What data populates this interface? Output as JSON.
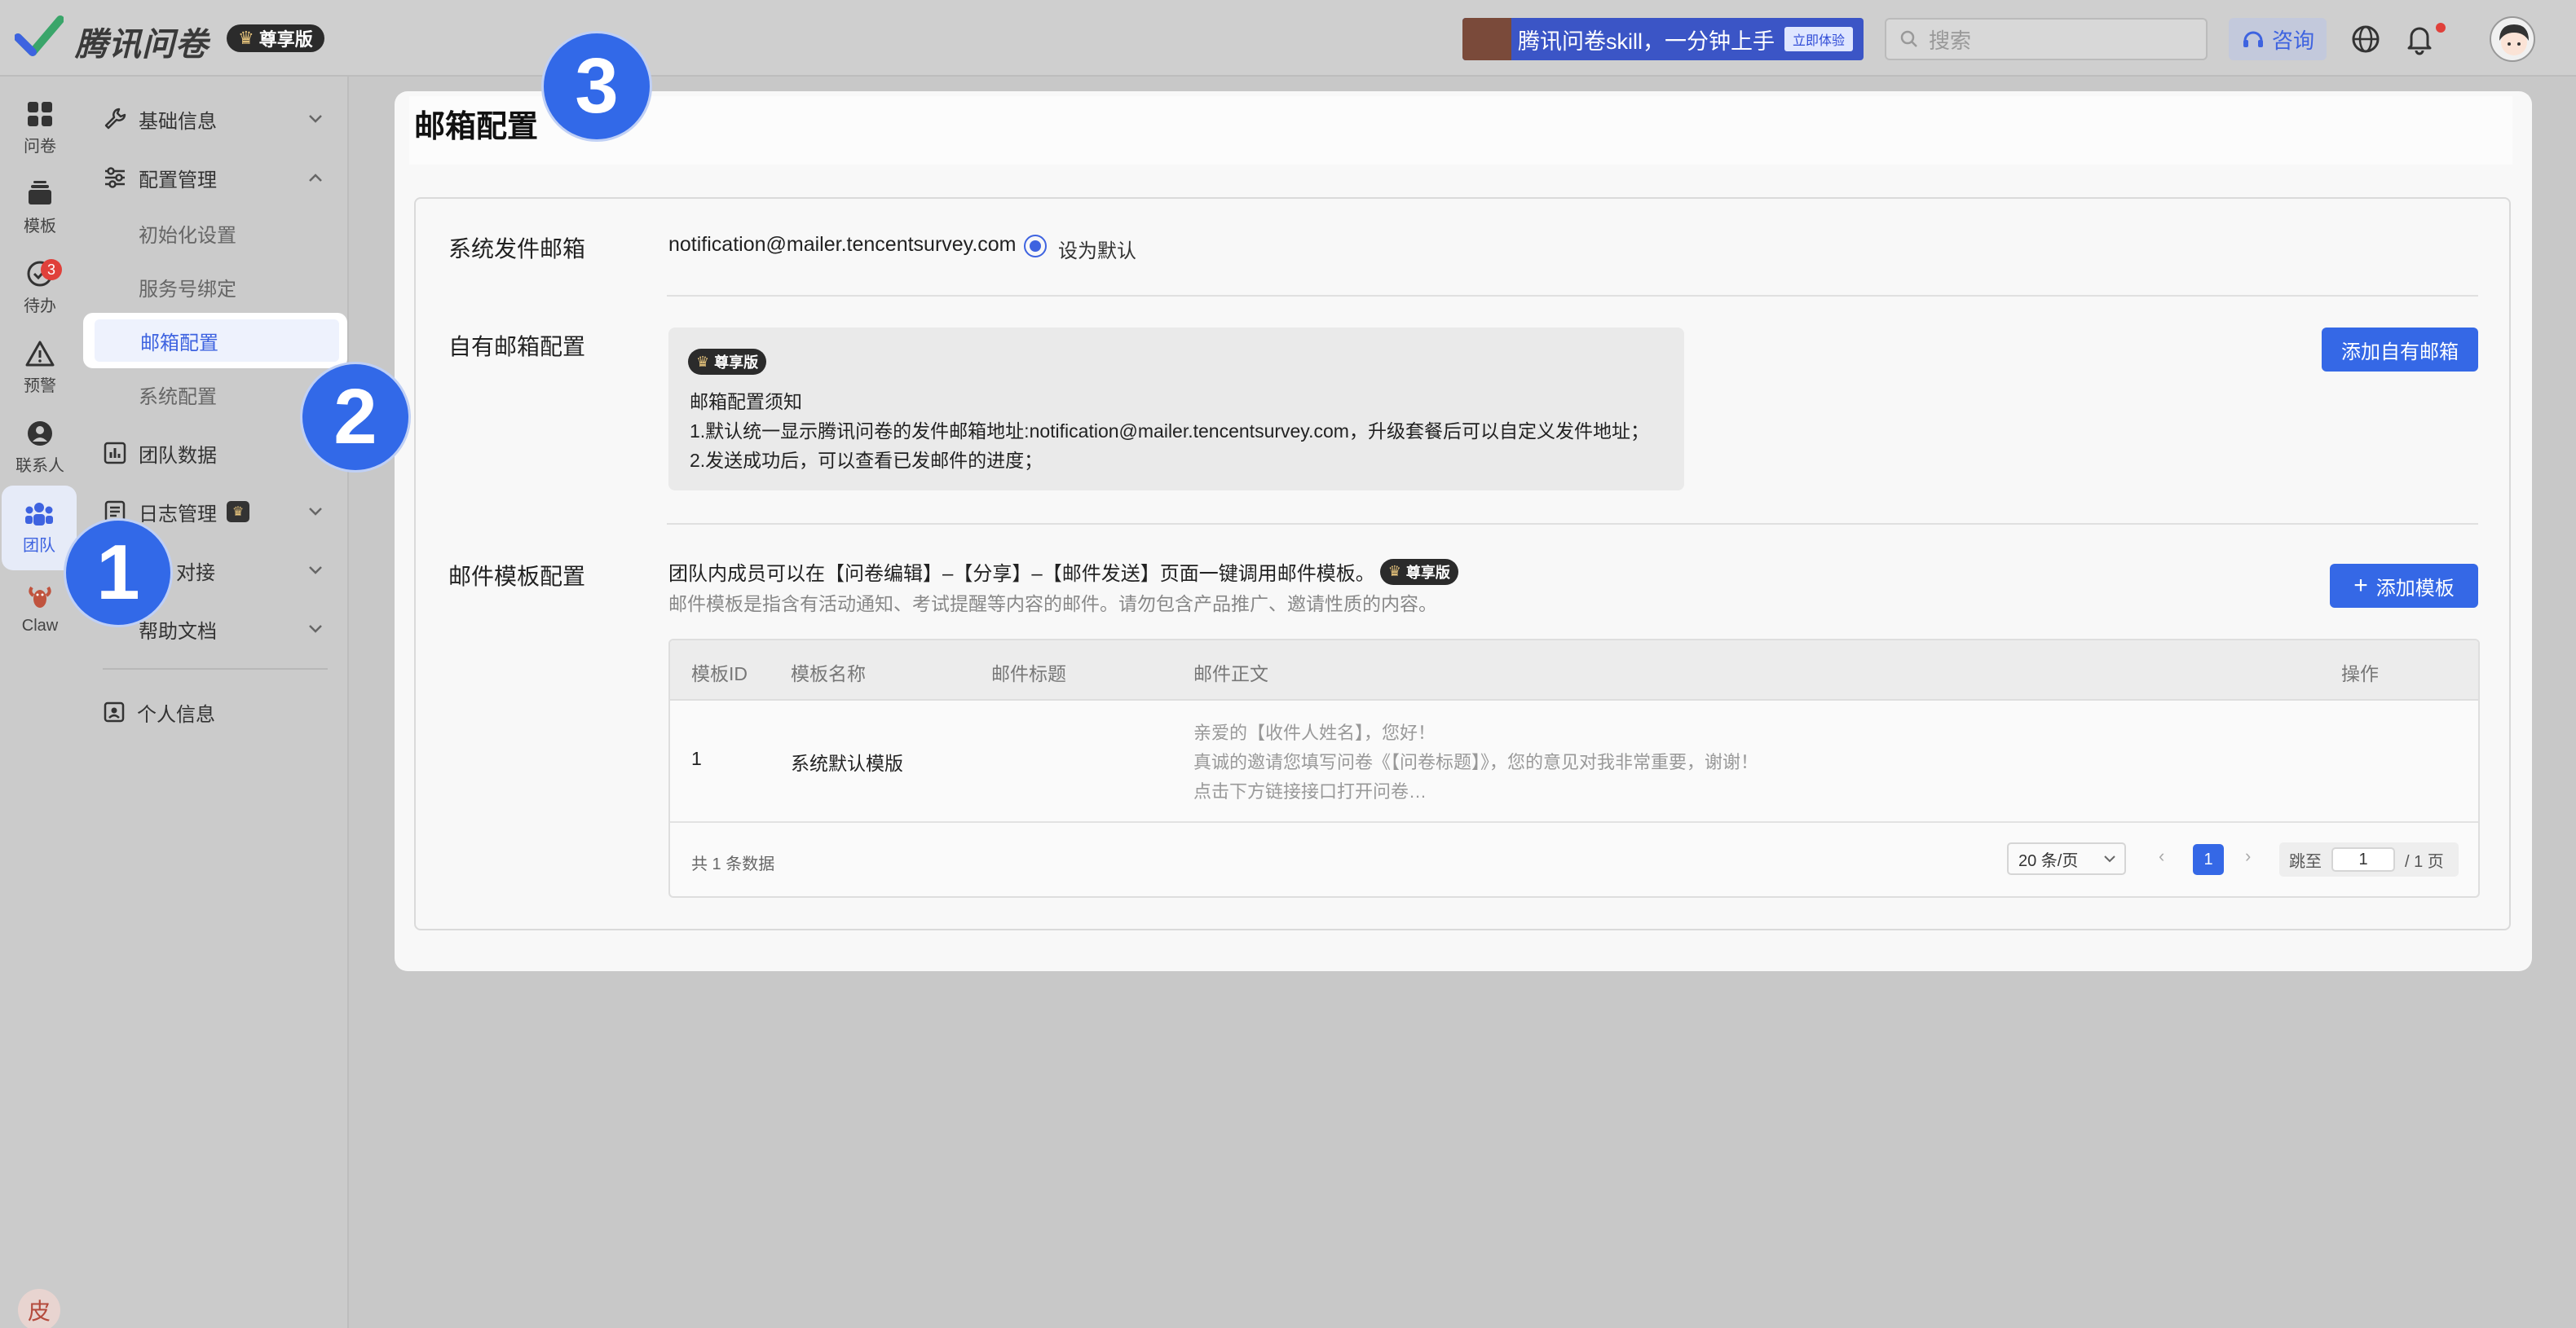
{
  "app": {
    "name": "腾讯问卷",
    "edition": "尊享版"
  },
  "topbar": {
    "banner_text": "腾讯问卷skill，一分钟上手",
    "banner_button": "立即体验",
    "search_placeholder": "搜索",
    "consult_label": "咨询"
  },
  "rail": {
    "items": [
      {
        "label": "问卷",
        "icon": "grid-icon"
      },
      {
        "label": "模板",
        "icon": "template-icon"
      },
      {
        "label": "待办",
        "icon": "todo-icon",
        "badge": "3"
      },
      {
        "label": "预警",
        "icon": "warning-icon"
      },
      {
        "label": "联系人",
        "icon": "contact-icon"
      },
      {
        "label": "团队",
        "icon": "team-icon",
        "active": true
      },
      {
        "label": "Claw",
        "icon": "lobster-icon"
      }
    ],
    "user_initial": "皮",
    "menu_glyph": "☰"
  },
  "sidemenu": {
    "basic_info": "基础信息",
    "config_mgmt": "配置管理",
    "sub": [
      "初始化设置",
      "服务号绑定",
      "邮箱配置",
      "系统配置"
    ],
    "team_data": "团队数据",
    "log_mgmt": "日志管理",
    "integration": "对接",
    "help_docs": "帮助文档",
    "profile": "个人信息"
  },
  "steps": [
    "1",
    "2",
    "3"
  ],
  "page": {
    "title": "邮箱配置",
    "sys_sender_label": "系统发件邮箱",
    "sys_sender_email": "notification@mailer.tencentsurvey.com",
    "default_radio": "设为默认",
    "own_mail_label": "自有邮箱配置",
    "notice_badge": "尊享版",
    "notice_title": "邮箱配置须知",
    "notice_line1": "1.默认统一显示腾讯问卷的发件邮箱地址:notification@mailer.tencentsurvey.com，升级套餐后可以自定义发件地址；",
    "notice_line2": "2.发送成功后，可以查看已发邮件的进度；",
    "add_own_mail": "添加自有邮箱",
    "tpl_label": "邮件模板配置",
    "tpl_desc1": "团队内成员可以在【问卷编辑】–【分享】–【邮件发送】页面一键调用邮件模板。",
    "tpl_desc2": "邮件模板是指含有活动通知、考试提醒等内容的邮件。请勿包含产品推广、邀请性质的内容。",
    "add_tpl": "添加模板"
  },
  "table": {
    "headers": [
      "模板ID",
      "模板名称",
      "邮件标题",
      "邮件正文",
      "操作"
    ],
    "rows": [
      {
        "id": "1",
        "name": "系统默认模版",
        "subject": "",
        "body": [
          "亲爱的【收件人姓名】，您好！",
          "真诚的邀请您填写问卷《【问卷标题】》，您的意见对我非常重要，谢谢！",
          "点击下方链接接口打开问卷…"
        ]
      }
    ],
    "total": "共 1 条数据",
    "page_size": "20 条/页",
    "current_page": "1",
    "jump_label": "跳至",
    "jump_value": "1",
    "page_total": "/ 1 页"
  },
  "colors": {
    "accent": "#3568e6",
    "step": "#3269e8",
    "badge_red": "#e0403a"
  }
}
